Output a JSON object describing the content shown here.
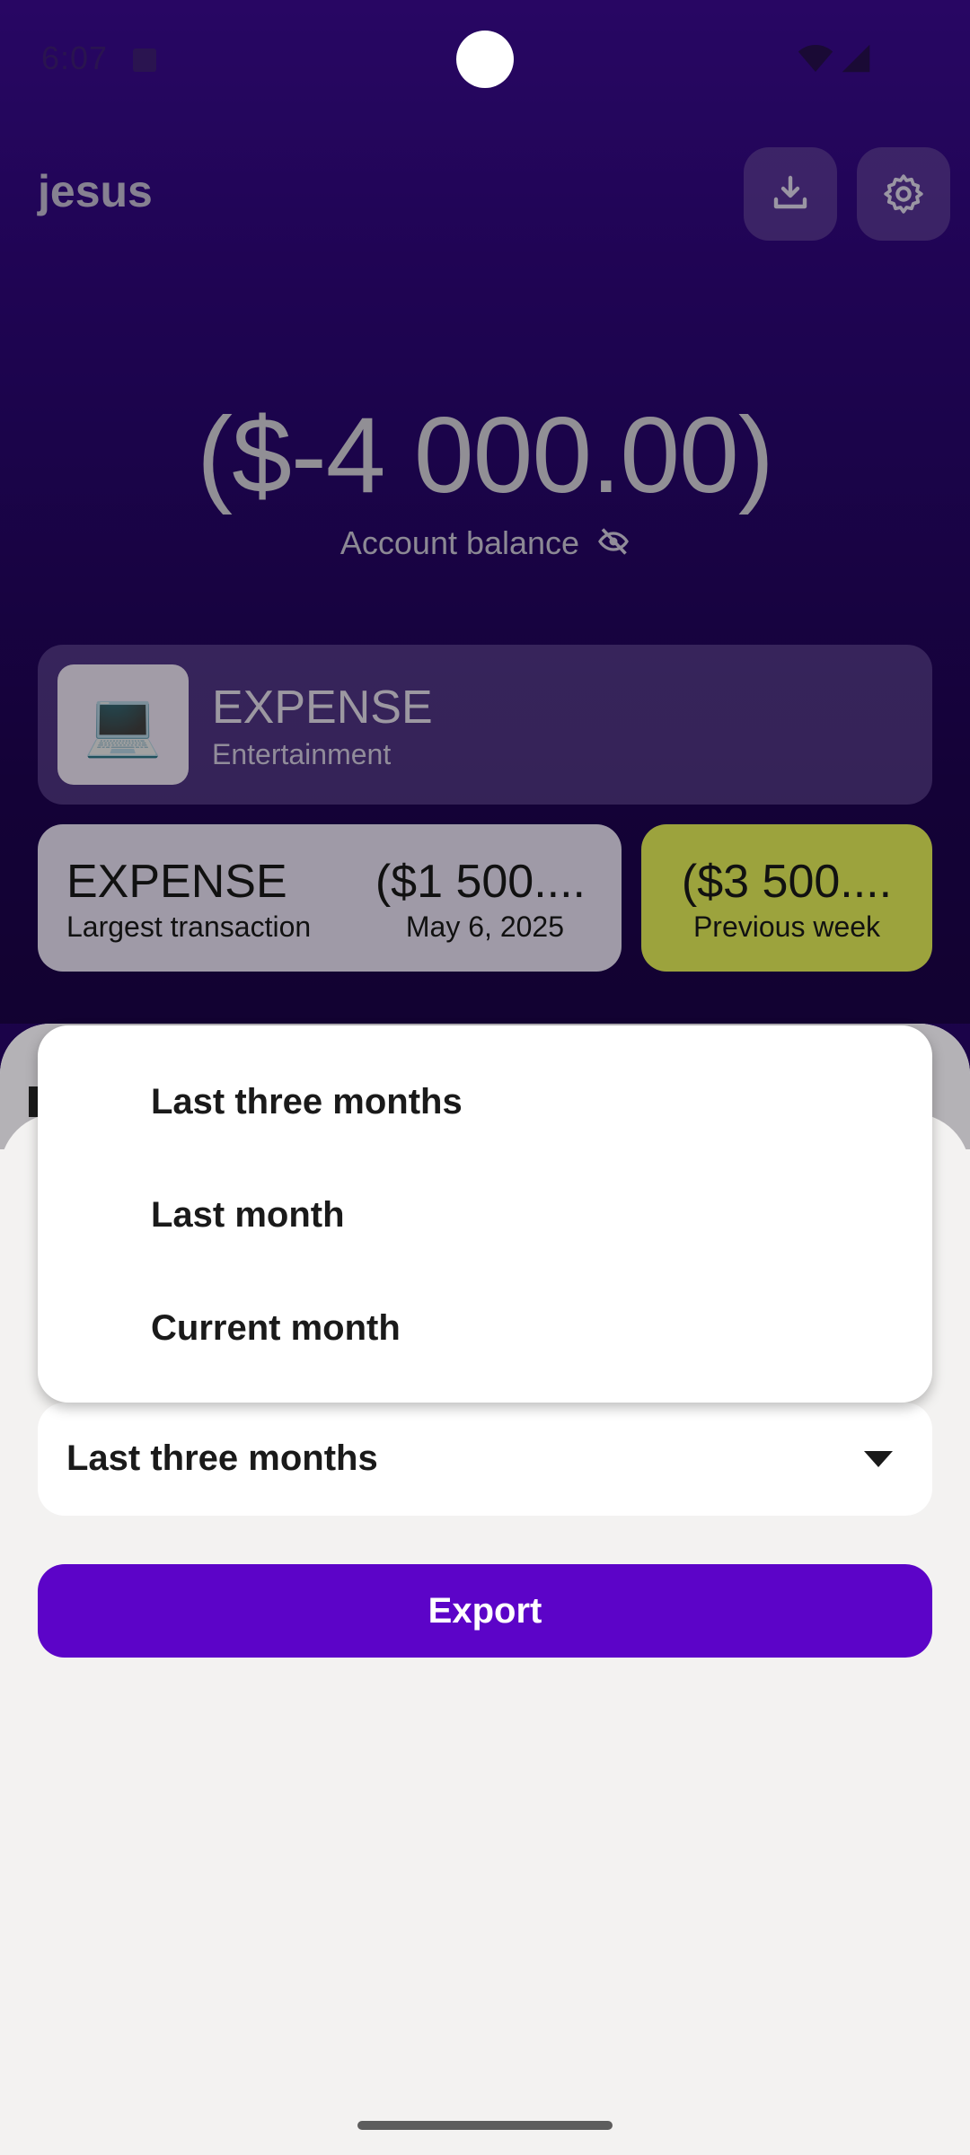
{
  "status_bar": {
    "time": "6:07"
  },
  "header": {
    "title": "jesus",
    "download_icon": "download-icon",
    "settings_icon": "gear-icon"
  },
  "balance": {
    "amount": "($-4 000.00)",
    "label": "Account balance"
  },
  "latest_transaction": {
    "emoji": "💻",
    "type": "EXPENSE",
    "category": "Entertainment"
  },
  "largest_transaction": {
    "type": "EXPENSE",
    "label": "Largest transaction",
    "amount": "($1 500....",
    "date": "May 6, 2025"
  },
  "previous_week": {
    "amount": "($3 500....",
    "label": "Previous week"
  },
  "export_sheet": {
    "selected_period": "Last three months",
    "export_label": "Export"
  },
  "dropdown": {
    "options": [
      "Last three months",
      "Last month",
      "Current month"
    ]
  },
  "colors": {
    "accent": "#5c04c8",
    "hero_top": "#3b0a93",
    "week_card": "#e6f05a"
  }
}
